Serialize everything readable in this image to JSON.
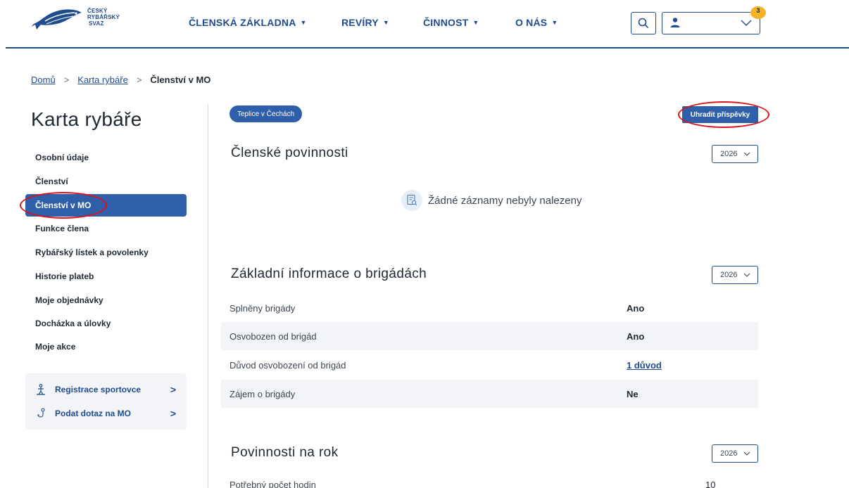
{
  "header": {
    "logo": {
      "line1": "ČESKÝ",
      "line2": "RYBÁŘSKÝ",
      "line3": "SVAZ"
    },
    "nav": [
      {
        "label": "ČLENSKÁ ZÁKLADNA"
      },
      {
        "label": "REVÍRY"
      },
      {
        "label": "ČINNOST"
      },
      {
        "label": "O NÁS"
      }
    ],
    "notification_count": "3"
  },
  "breadcrumb": {
    "items": [
      {
        "label": "Domů"
      },
      {
        "label": "Karta rybáře"
      }
    ],
    "current": "Členství v MO",
    "separator": ">"
  },
  "sidebar": {
    "title": "Karta rybáře",
    "items": [
      {
        "label": "Osobní údaje"
      },
      {
        "label": "Členství"
      },
      {
        "label": "Členství v MO"
      },
      {
        "label": "Funkce člena"
      },
      {
        "label": "Rybářský lístek a povolenky"
      },
      {
        "label": "Historie plateb"
      },
      {
        "label": "Moje objednávky"
      },
      {
        "label": "Docházka a úlovky"
      },
      {
        "label": "Moje akce"
      }
    ],
    "links": [
      {
        "label": "Registrace sportovce"
      },
      {
        "label": "Podat dotaz na MO"
      }
    ]
  },
  "main": {
    "organization_pill": "Teplice v Čechách",
    "pay_button": "Uhradit příspěvky",
    "sections": {
      "obligations": {
        "title": "Členské povinnosti",
        "year": "2026",
        "empty": "Žádné záznamy nebyly nalezeny"
      },
      "brigades": {
        "title": "Základní informace o brigádách",
        "year": "2026",
        "rows": [
          {
            "label": "Splněny brigády",
            "value": "Ano"
          },
          {
            "label": "Osvobozen od brigád",
            "value": "Ano"
          },
          {
            "label": "Důvod osvobození od brigád",
            "value": "1 důvod"
          },
          {
            "label": "Zájem o brigády",
            "value": "Ne"
          }
        ]
      },
      "yearly": {
        "title": "Povinnosti na rok",
        "year": "2026",
        "rows": [
          {
            "label": "Potřebný počet hodin",
            "value": "10"
          }
        ]
      }
    }
  },
  "colors": {
    "brand": "#1f4c8f",
    "accent": "#2f5fa8",
    "badge": "#f3b527",
    "annotation": "#e0101a"
  }
}
